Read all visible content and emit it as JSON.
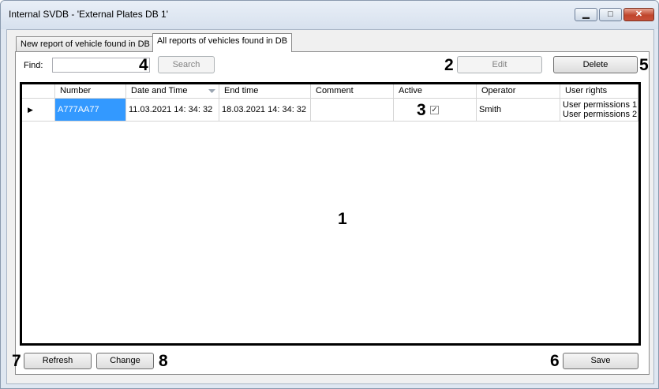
{
  "window": {
    "title": "Internal SVDB - 'External Plates DB 1'",
    "controls": {
      "minimize": "▁",
      "maximize": "□",
      "close": "✕"
    }
  },
  "tabs": [
    {
      "label": "New report of vehicle found in DB",
      "active": false
    },
    {
      "label": "All reports of vehicles found in DB",
      "active": true
    }
  ],
  "toolbar": {
    "find_label": "Find:",
    "find_value": "",
    "search_label": "Search",
    "edit_label": "Edit",
    "delete_label": "Delete"
  },
  "table": {
    "columns": [
      "",
      "Number",
      "Date and Time",
      "End time",
      "Comment",
      "Active",
      "Operator",
      "User rights"
    ],
    "rows": [
      {
        "indicator": "▶",
        "number": "A777AA77",
        "date_time": "11.03.2021 14: 34: 32",
        "end_time": "18.03.2021 14: 34: 32",
        "comment": "",
        "active": true,
        "operator": "Smith",
        "user_rights": [
          "User permissions 1",
          "User permissions 2"
        ]
      }
    ],
    "sort_icon": "sort-descending-icon"
  },
  "bottom": {
    "refresh_label": "Refresh",
    "change_label": "Change",
    "save_label": "Save"
  },
  "callouts": [
    "1",
    "2",
    "3",
    "4",
    "5",
    "6",
    "7",
    "8"
  ],
  "colors": {
    "selection": "#3399ff",
    "window_frame": "#dfe7f1",
    "close_button": "#c0452c"
  }
}
